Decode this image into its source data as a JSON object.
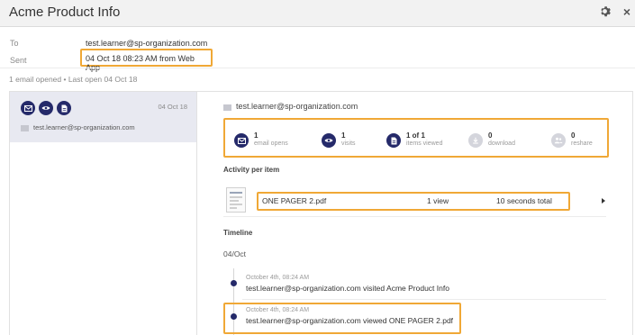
{
  "window": {
    "title": "Acme Product Info"
  },
  "meta": {
    "to_label": "To",
    "to_value": "test.learner@sp-organization.com",
    "sent_label": "Sent",
    "sent_value": "04 Oct 18 08:23 AM from Web App"
  },
  "summary": "1 email opened • Last open 04 Oct 18",
  "recipient_card": {
    "date": "04 Oct 18",
    "email": "test.learner@sp-organization.com",
    "icons": [
      "envelope-icon",
      "eye-icon",
      "document-icon"
    ]
  },
  "detail": {
    "email": "test.learner@sp-organization.com",
    "stats": [
      {
        "value": "1",
        "label": "email opens",
        "icon": "envelope-icon",
        "active": true
      },
      {
        "value": "1",
        "label": "visits",
        "icon": "eye-icon",
        "active": true
      },
      {
        "value": "1 of 1",
        "label": "items viewed",
        "icon": "document-icon",
        "active": true
      },
      {
        "value": "0",
        "label": "download",
        "icon": "download-icon",
        "active": false
      },
      {
        "value": "0",
        "label": "reshare",
        "icon": "people-icon",
        "active": false
      }
    ],
    "activity_title": "Activity per item",
    "item": {
      "name": "ONE PAGER 2.pdf",
      "views": "1 view",
      "total": "10 seconds total"
    },
    "timeline_title": "Timeline",
    "timeline_date": "04/Oct",
    "events": [
      {
        "time": "October 4th, 08:24 AM",
        "text": "test.learner@sp-organization.com visited Acme Product Info"
      },
      {
        "time": "October 4th, 08:24 AM",
        "text": "test.learner@sp-organization.com viewed ONE PAGER 2.pdf"
      }
    ]
  },
  "colors": {
    "accent": "#252a6a",
    "highlight": "#f0a836",
    "card_bg": "#e8e9f1"
  }
}
